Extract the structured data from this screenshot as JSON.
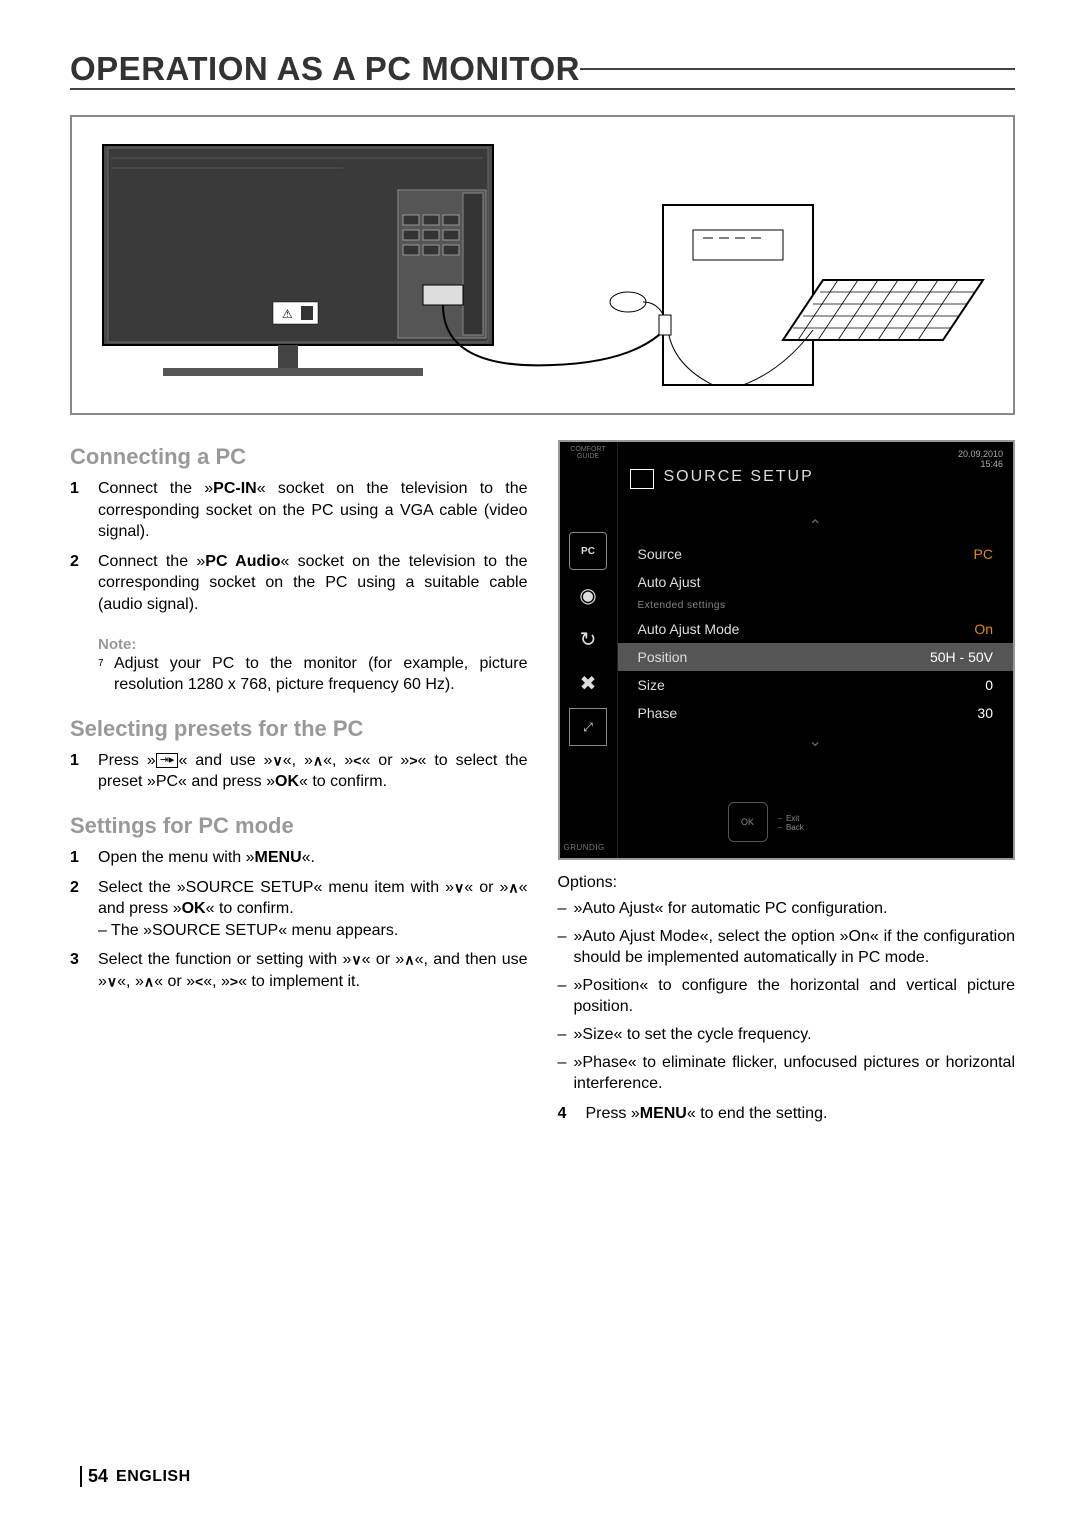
{
  "title": "OPERATION AS A PC MONITOR",
  "sections": {
    "connecting": {
      "heading": "Connecting a PC",
      "steps": [
        {
          "num": "1",
          "text_pre": "Connect the »",
          "bold": "PC-IN",
          "text_post": "« socket on the television to the corresponding socket on the PC using a VGA cable (video signal)."
        },
        {
          "num": "2",
          "text_pre": "Connect the »",
          "bold": "PC Audio",
          "text_post": "« socket on the television to the corresponding socket on the PC using a suitable cable (audio signal)."
        }
      ],
      "note_heading": "Note:",
      "note_text": "Adjust your PC to the monitor (for example, picture resolution 1280 x 768, picture frequency 60 Hz)."
    },
    "selecting": {
      "heading": "Selecting presets for the PC",
      "step_num": "1",
      "step_text_pre": "Press »",
      "step_text_mid1": "« and use »",
      "step_text_mid2": "«, »",
      "step_text_mid3": "«, »",
      "step_text_mid4": "« or »",
      "step_text_post": "« to select the preset »PC« and press »",
      "ok": "OK",
      "step_text_end": "« to confirm."
    },
    "settings": {
      "heading": "Settings for PC mode",
      "steps": [
        {
          "num": "1",
          "pre": "Open the menu with »",
          "bold": "MENU",
          "post": "«."
        },
        {
          "num": "2",
          "pre": "Select the »SOURCE SETUP« menu item with »",
          "mid": "« or »",
          "post": "« and press »",
          "bold": "OK",
          "end": "« to confirm.",
          "sub": "– The »SOURCE SETUP« menu appears."
        },
        {
          "num": "3",
          "pre": "Select the function or setting with »",
          "mid1": "« or »",
          "mid2": "«, and then use »",
          "mid3": "«, »",
          "mid4": "« or »",
          "mid5": "«, »",
          "post": "« to implement it."
        }
      ]
    },
    "options": {
      "heading": "Options:",
      "list": [
        "»Auto Ajust« for automatic PC configuration.",
        "»Auto Ajust Mode«, select the option »On« if the configuration should be implemented automatically in PC mode.",
        "»Position« to configure the horizontal and vertical picture position.",
        "»Size« to set the cycle frequency.",
        "»Phase« to eliminate flicker, unfocused pictures or horizontal interference."
      ],
      "step4_num": "4",
      "step4_pre": "Press »",
      "step4_bold": "MENU",
      "step4_post": "« to end the setting."
    }
  },
  "osd": {
    "comfort": "COMFORT\nGUIDE",
    "title": "SOURCE SETUP",
    "date": "20.09.2010",
    "time": "15:46",
    "rows": [
      {
        "label": "Source",
        "value": "PC",
        "highlight": false
      },
      {
        "label": "Auto Ajust",
        "value": "",
        "highlight": false
      }
    ],
    "extended_label": "Extended settings",
    "ext_rows": [
      {
        "label": "Auto Ajust Mode",
        "value": "On",
        "highlight": false
      },
      {
        "label": "Position",
        "value": "50H - 50V",
        "highlight": true
      },
      {
        "label": "Size",
        "value": "0",
        "highlight": false
      },
      {
        "label": "Phase",
        "value": "30",
        "highlight": false
      }
    ],
    "exit": "Exit",
    "back": "Back",
    "brand": "GRUNDIG"
  },
  "footer": {
    "page": "54",
    "lang": "ENGLISH"
  }
}
